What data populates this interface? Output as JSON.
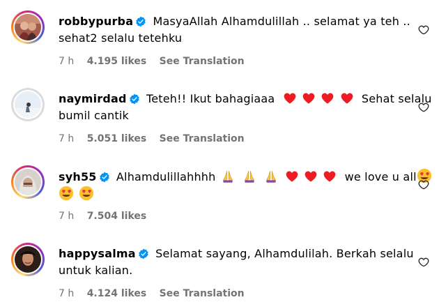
{
  "comments": [
    {
      "username": "robbypurba",
      "verified": true,
      "line1": "MasyaAllah Alhamdulillah .. selamat ya teh ..",
      "line2": "sehat2 selalu tetehku",
      "time": "7 h",
      "likes": "4.195 likes",
      "translate": "See Translation",
      "icons": [
        "heart-outline-icon"
      ]
    },
    {
      "username": "naymirdad",
      "verified": true,
      "line1_before": "Teteh!! Ikut bahagiaaa",
      "line1_after": "Sehat selalu",
      "line2": "bumil cantik",
      "time": "7 h",
      "likes": "5.051 likes",
      "translate": "See Translation",
      "emoji": [
        "red-heart",
        "red-heart",
        "red-heart",
        "red-heart"
      ]
    },
    {
      "username": "syh55",
      "verified": true,
      "line1_before": "Alhamdulillahhhh",
      "line1_mid": "we love u all",
      "time": "7 h",
      "likes": "7.504 likes",
      "emoji": [
        "folded-hands",
        "folded-hands",
        "folded-hands",
        "red-heart",
        "red-heart",
        "red-heart",
        "heart-eyes-face",
        "heart-eyes-face",
        "heart-eyes-face"
      ]
    },
    {
      "username": "happysalma",
      "verified": true,
      "line1": "Selamat sayang, Alhamdulilah. Berkah selalu",
      "line2": "untuk kalian.",
      "time": "7 h",
      "likes": "4.124 likes",
      "translate": "See Translation"
    }
  ],
  "colors": {
    "verified": "#0095f6",
    "meta": "#737373",
    "heart": "#ed1c24"
  }
}
